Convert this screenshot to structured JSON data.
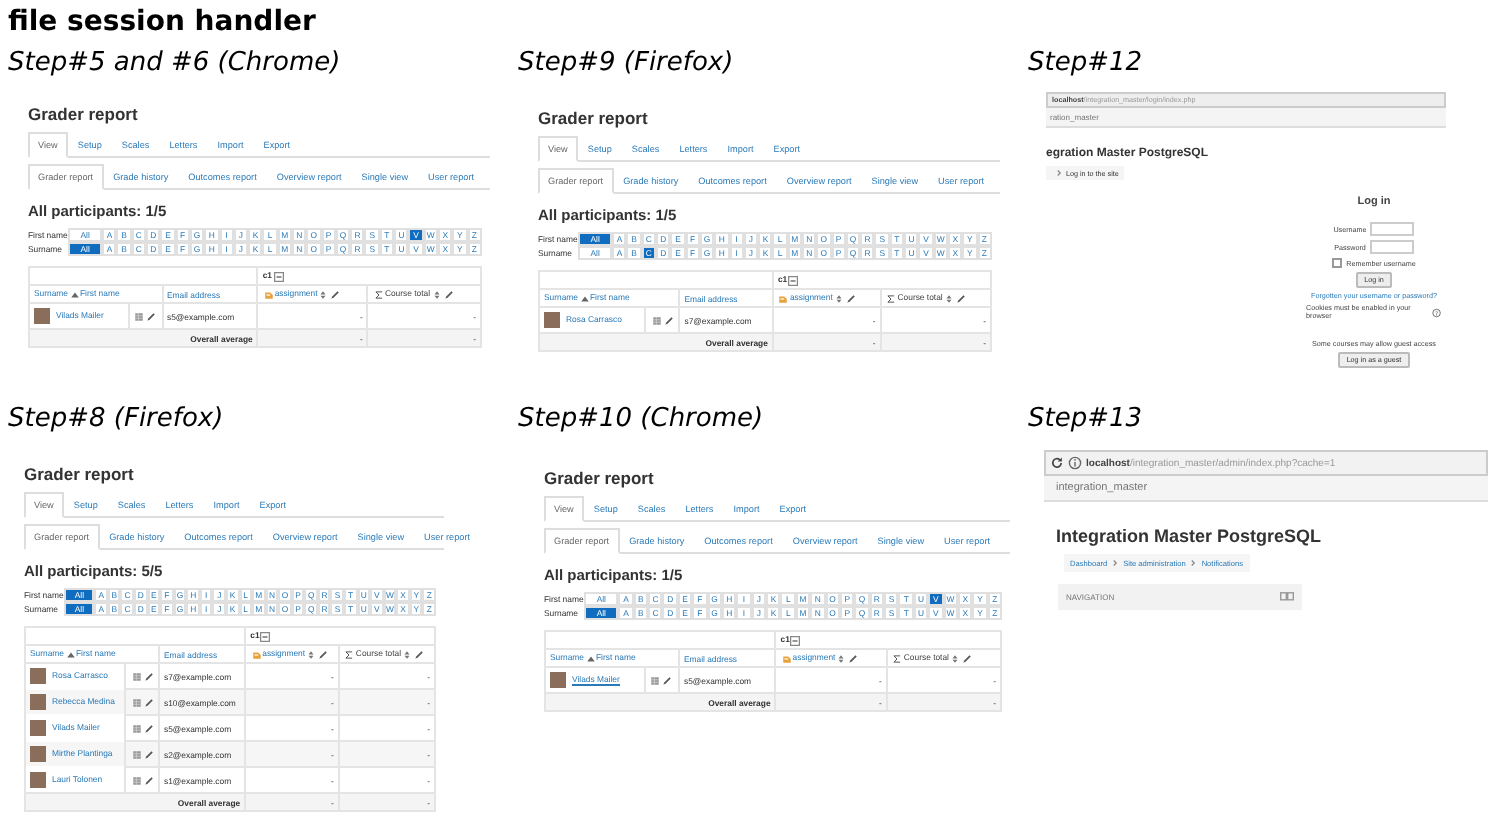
{
  "sheet_title": "file session handler",
  "panels": [
    {
      "kind": "grader",
      "caption": "Step#5 and #6 (Chrome)",
      "title": "Grader report",
      "tabs": [
        {
          "label": "View",
          "selected": true
        },
        {
          "label": "Setup",
          "selected": false
        },
        {
          "label": "Scales",
          "selected": false
        },
        {
          "label": "Letters",
          "selected": false
        },
        {
          "label": "Import",
          "selected": false
        },
        {
          "label": "Export",
          "selected": false
        }
      ],
      "subtabs": [
        {
          "label": "Grader report",
          "selected": true
        },
        {
          "label": "Grade history",
          "selected": false
        },
        {
          "label": "Outcomes report",
          "selected": false
        },
        {
          "label": "Overview report",
          "selected": false
        },
        {
          "label": "Single view",
          "selected": false
        },
        {
          "label": "User report",
          "selected": false
        }
      ],
      "participants": "All participants: 1/5",
      "filters": [
        {
          "label": "First name",
          "letters": [
            {
              "label": "All",
              "selected": false
            },
            {
              "label": "A",
              "selected": false
            },
            {
              "label": "B",
              "selected": false
            },
            {
              "label": "C",
              "selected": false
            },
            {
              "label": "D",
              "selected": false
            },
            {
              "label": "E",
              "selected": false
            },
            {
              "label": "F",
              "selected": false
            },
            {
              "label": "G",
              "selected": false
            },
            {
              "label": "H",
              "selected": false
            },
            {
              "label": "I",
              "selected": false
            },
            {
              "label": "J",
              "selected": false
            },
            {
              "label": "K",
              "selected": false
            },
            {
              "label": "L",
              "selected": false
            },
            {
              "label": "M",
              "selected": false
            },
            {
              "label": "N",
              "selected": false
            },
            {
              "label": "O",
              "selected": false
            },
            {
              "label": "P",
              "selected": false
            },
            {
              "label": "Q",
              "selected": false
            },
            {
              "label": "R",
              "selected": false
            },
            {
              "label": "S",
              "selected": false
            },
            {
              "label": "T",
              "selected": false
            },
            {
              "label": "U",
              "selected": false
            },
            {
              "label": "V",
              "selected": true
            },
            {
              "label": "W",
              "selected": false
            },
            {
              "label": "X",
              "selected": false
            },
            {
              "label": "Y",
              "selected": false
            },
            {
              "label": "Z",
              "selected": false
            }
          ]
        },
        {
          "label": "Surname",
          "letters": [
            {
              "label": "All",
              "selected": true
            },
            {
              "label": "A",
              "selected": false
            },
            {
              "label": "B",
              "selected": false
            },
            {
              "label": "C",
              "selected": false
            },
            {
              "label": "D",
              "selected": false
            },
            {
              "label": "E",
              "selected": false
            },
            {
              "label": "F",
              "selected": false
            },
            {
              "label": "G",
              "selected": false
            },
            {
              "label": "H",
              "selected": false
            },
            {
              "label": "I",
              "selected": false
            },
            {
              "label": "J",
              "selected": false
            },
            {
              "label": "K",
              "selected": false
            },
            {
              "label": "L",
              "selected": false
            },
            {
              "label": "M",
              "selected": false
            },
            {
              "label": "N",
              "selected": false
            },
            {
              "label": "O",
              "selected": false
            },
            {
              "label": "P",
              "selected": false
            },
            {
              "label": "Q",
              "selected": false
            },
            {
              "label": "R",
              "selected": false
            },
            {
              "label": "S",
              "selected": false
            },
            {
              "label": "T",
              "selected": false
            },
            {
              "label": "U",
              "selected": false
            },
            {
              "label": "V",
              "selected": false
            },
            {
              "label": "W",
              "selected": false
            },
            {
              "label": "X",
              "selected": false
            },
            {
              "label": "Y",
              "selected": false
            },
            {
              "label": "Z",
              "selected": false
            }
          ]
        }
      ],
      "table": {
        "category": "c1",
        "columns": [
          "Surname",
          "First name",
          "Email address",
          "assignment",
          "Course total"
        ],
        "rows": [
          {
            "name": "Vilads Mailer",
            "email": "s5@example.com",
            "grade": "-",
            "total": "-",
            "underlined": false
          }
        ],
        "footer": {
          "label": "Overall average",
          "grade": "-",
          "total": "-"
        }
      }
    },
    {
      "kind": "grader",
      "caption": "Step#9 (Firefox)",
      "title": "Grader report",
      "tabs": [
        {
          "label": "View",
          "selected": true
        },
        {
          "label": "Setup",
          "selected": false
        },
        {
          "label": "Scales",
          "selected": false
        },
        {
          "label": "Letters",
          "selected": false
        },
        {
          "label": "Import",
          "selected": false
        },
        {
          "label": "Export",
          "selected": false
        }
      ],
      "subtabs": [
        {
          "label": "Grader report",
          "selected": true
        },
        {
          "label": "Grade history",
          "selected": false
        },
        {
          "label": "Outcomes report",
          "selected": false
        },
        {
          "label": "Overview report",
          "selected": false
        },
        {
          "label": "Single view",
          "selected": false
        },
        {
          "label": "User report",
          "selected": false
        }
      ],
      "participants": "All participants: 1/5",
      "filters": [
        {
          "label": "First name",
          "letters": [
            {
              "label": "All",
              "selected": true
            },
            {
              "label": "A",
              "selected": false
            },
            {
              "label": "B",
              "selected": false
            },
            {
              "label": "C",
              "selected": false
            },
            {
              "label": "D",
              "selected": false
            },
            {
              "label": "E",
              "selected": false
            },
            {
              "label": "F",
              "selected": false
            },
            {
              "label": "G",
              "selected": false
            },
            {
              "label": "H",
              "selected": false
            },
            {
              "label": "I",
              "selected": false
            },
            {
              "label": "J",
              "selected": false
            },
            {
              "label": "K",
              "selected": false
            },
            {
              "label": "L",
              "selected": false
            },
            {
              "label": "M",
              "selected": false
            },
            {
              "label": "N",
              "selected": false
            },
            {
              "label": "O",
              "selected": false
            },
            {
              "label": "P",
              "selected": false
            },
            {
              "label": "Q",
              "selected": false
            },
            {
              "label": "R",
              "selected": false
            },
            {
              "label": "S",
              "selected": false
            },
            {
              "label": "T",
              "selected": false
            },
            {
              "label": "U",
              "selected": false
            },
            {
              "label": "V",
              "selected": false
            },
            {
              "label": "W",
              "selected": false
            },
            {
              "label": "X",
              "selected": false
            },
            {
              "label": "Y",
              "selected": false
            },
            {
              "label": "Z",
              "selected": false
            }
          ]
        },
        {
          "label": "Surname",
          "letters": [
            {
              "label": "All",
              "selected": false
            },
            {
              "label": "A",
              "selected": false
            },
            {
              "label": "B",
              "selected": false
            },
            {
              "label": "C",
              "selected": true
            },
            {
              "label": "D",
              "selected": false
            },
            {
              "label": "E",
              "selected": false
            },
            {
              "label": "F",
              "selected": false
            },
            {
              "label": "G",
              "selected": false
            },
            {
              "label": "H",
              "selected": false
            },
            {
              "label": "I",
              "selected": false
            },
            {
              "label": "J",
              "selected": false
            },
            {
              "label": "K",
              "selected": false
            },
            {
              "label": "L",
              "selected": false
            },
            {
              "label": "M",
              "selected": false
            },
            {
              "label": "N",
              "selected": false
            },
            {
              "label": "O",
              "selected": false
            },
            {
              "label": "P",
              "selected": false
            },
            {
              "label": "Q",
              "selected": false
            },
            {
              "label": "R",
              "selected": false
            },
            {
              "label": "S",
              "selected": false
            },
            {
              "label": "T",
              "selected": false
            },
            {
              "label": "U",
              "selected": false
            },
            {
              "label": "V",
              "selected": false
            },
            {
              "label": "W",
              "selected": false
            },
            {
              "label": "X",
              "selected": false
            },
            {
              "label": "Y",
              "selected": false
            },
            {
              "label": "Z",
              "selected": false
            }
          ]
        }
      ],
      "table": {
        "category": "c1",
        "columns": [
          "Surname",
          "First name",
          "Email address",
          "assignment",
          "Course total"
        ],
        "rows": [
          {
            "name": "Rosa Carrasco",
            "email": "s7@example.com",
            "grade": "-",
            "total": "-",
            "underlined": false
          }
        ],
        "footer": {
          "label": "Overall average",
          "grade": "-",
          "total": "-"
        }
      }
    },
    {
      "kind": "login",
      "caption": "Step#12",
      "url_host": "localhost",
      "url_path": "/integration_master/login/index.php",
      "site_name": "ration_master",
      "heading": "egration Master PostgreSQL",
      "breadcrumb": [
        "Log in to the site"
      ],
      "login_title": "Log in",
      "username_label": "Username",
      "password_label": "Password",
      "remember_label": "Remember username",
      "remember_checked": false,
      "login_button": "Log in",
      "forgot_link": "Forgotten your username or password?",
      "cookies_note": "Cookies must be enabled in your browser",
      "guest_note": "Some courses may allow guest access",
      "guest_button": "Log in as a guest"
    },
    {
      "kind": "grader",
      "caption": "Step#8 (Firefox)",
      "title": "Grader report",
      "tabs": [
        {
          "label": "View",
          "selected": true
        },
        {
          "label": "Setup",
          "selected": false
        },
        {
          "label": "Scales",
          "selected": false
        },
        {
          "label": "Letters",
          "selected": false
        },
        {
          "label": "Import",
          "selected": false
        },
        {
          "label": "Export",
          "selected": false
        }
      ],
      "subtabs": [
        {
          "label": "Grader report",
          "selected": true
        },
        {
          "label": "Grade history",
          "selected": false
        },
        {
          "label": "Outcomes report",
          "selected": false
        },
        {
          "label": "Overview report",
          "selected": false
        },
        {
          "label": "Single view",
          "selected": false
        },
        {
          "label": "User report",
          "selected": false
        }
      ],
      "participants": "All participants: 5/5",
      "filters": [
        {
          "label": "First name",
          "letters": [
            {
              "label": "All",
              "selected": true
            },
            {
              "label": "A",
              "selected": false
            },
            {
              "label": "B",
              "selected": false
            },
            {
              "label": "C",
              "selected": false
            },
            {
              "label": "D",
              "selected": false
            },
            {
              "label": "E",
              "selected": false
            },
            {
              "label": "F",
              "selected": false
            },
            {
              "label": "G",
              "selected": false
            },
            {
              "label": "H",
              "selected": false
            },
            {
              "label": "I",
              "selected": false
            },
            {
              "label": "J",
              "selected": false
            },
            {
              "label": "K",
              "selected": false
            },
            {
              "label": "L",
              "selected": false
            },
            {
              "label": "M",
              "selected": false
            },
            {
              "label": "N",
              "selected": false
            },
            {
              "label": "O",
              "selected": false
            },
            {
              "label": "P",
              "selected": false
            },
            {
              "label": "Q",
              "selected": false
            },
            {
              "label": "R",
              "selected": false
            },
            {
              "label": "S",
              "selected": false
            },
            {
              "label": "T",
              "selected": false
            },
            {
              "label": "U",
              "selected": false
            },
            {
              "label": "V",
              "selected": false
            },
            {
              "label": "W",
              "selected": false
            },
            {
              "label": "X",
              "selected": false
            },
            {
              "label": "Y",
              "selected": false
            },
            {
              "label": "Z",
              "selected": false
            }
          ]
        },
        {
          "label": "Surname",
          "letters": [
            {
              "label": "All",
              "selected": true
            },
            {
              "label": "A",
              "selected": false
            },
            {
              "label": "B",
              "selected": false
            },
            {
              "label": "C",
              "selected": false
            },
            {
              "label": "D",
              "selected": false
            },
            {
              "label": "E",
              "selected": false
            },
            {
              "label": "F",
              "selected": false
            },
            {
              "label": "G",
              "selected": false
            },
            {
              "label": "H",
              "selected": false
            },
            {
              "label": "I",
              "selected": false
            },
            {
              "label": "J",
              "selected": false
            },
            {
              "label": "K",
              "selected": false
            },
            {
              "label": "L",
              "selected": false
            },
            {
              "label": "M",
              "selected": false
            },
            {
              "label": "N",
              "selected": false
            },
            {
              "label": "O",
              "selected": false
            },
            {
              "label": "P",
              "selected": false
            },
            {
              "label": "Q",
              "selected": false
            },
            {
              "label": "R",
              "selected": false
            },
            {
              "label": "S",
              "selected": false
            },
            {
              "label": "T",
              "selected": false
            },
            {
              "label": "U",
              "selected": false
            },
            {
              "label": "V",
              "selected": false
            },
            {
              "label": "W",
              "selected": false
            },
            {
              "label": "X",
              "selected": false
            },
            {
              "label": "Y",
              "selected": false
            },
            {
              "label": "Z",
              "selected": false
            }
          ]
        }
      ],
      "table": {
        "category": "c1",
        "columns": [
          "Surname",
          "First name",
          "Email address",
          "assignment",
          "Course total"
        ],
        "rows": [
          {
            "name": "Rosa Carrasco",
            "email": "s7@example.com",
            "grade": "-",
            "total": "-",
            "underlined": false
          },
          {
            "name": "Rebecca Medina",
            "email": "s10@example.com",
            "grade": "-",
            "total": "-",
            "underlined": false
          },
          {
            "name": "Vilads Mailer",
            "email": "s5@example.com",
            "grade": "-",
            "total": "-",
            "underlined": false
          },
          {
            "name": "Mirthe Plantinga",
            "email": "s2@example.com",
            "grade": "-",
            "total": "-",
            "underlined": false
          },
          {
            "name": "Lauri Tolonen",
            "email": "s1@example.com",
            "grade": "-",
            "total": "-",
            "underlined": false
          }
        ],
        "footer": {
          "label": "Overall average",
          "grade": "-",
          "total": "-"
        }
      }
    },
    {
      "kind": "grader",
      "caption": "Step#10 (Chrome)",
      "title": "Grader report",
      "tabs": [
        {
          "label": "View",
          "selected": true
        },
        {
          "label": "Setup",
          "selected": false
        },
        {
          "label": "Scales",
          "selected": false
        },
        {
          "label": "Letters",
          "selected": false
        },
        {
          "label": "Import",
          "selected": false
        },
        {
          "label": "Export",
          "selected": false
        }
      ],
      "subtabs": [
        {
          "label": "Grader report",
          "selected": true
        },
        {
          "label": "Grade history",
          "selected": false
        },
        {
          "label": "Outcomes report",
          "selected": false
        },
        {
          "label": "Overview report",
          "selected": false
        },
        {
          "label": "Single view",
          "selected": false
        },
        {
          "label": "User report",
          "selected": false
        }
      ],
      "participants": "All participants: 1/5",
      "filters": [
        {
          "label": "First name",
          "letters": [
            {
              "label": "All",
              "selected": false
            },
            {
              "label": "A",
              "selected": false
            },
            {
              "label": "B",
              "selected": false
            },
            {
              "label": "C",
              "selected": false
            },
            {
              "label": "D",
              "selected": false
            },
            {
              "label": "E",
              "selected": false
            },
            {
              "label": "F",
              "selected": false
            },
            {
              "label": "G",
              "selected": false
            },
            {
              "label": "H",
              "selected": false
            },
            {
              "label": "I",
              "selected": false
            },
            {
              "label": "J",
              "selected": false
            },
            {
              "label": "K",
              "selected": false
            },
            {
              "label": "L",
              "selected": false
            },
            {
              "label": "M",
              "selected": false
            },
            {
              "label": "N",
              "selected": false
            },
            {
              "label": "O",
              "selected": false
            },
            {
              "label": "P",
              "selected": false
            },
            {
              "label": "Q",
              "selected": false
            },
            {
              "label": "R",
              "selected": false
            },
            {
              "label": "S",
              "selected": false
            },
            {
              "label": "T",
              "selected": false
            },
            {
              "label": "U",
              "selected": false
            },
            {
              "label": "V",
              "selected": true
            },
            {
              "label": "W",
              "selected": false
            },
            {
              "label": "X",
              "selected": false
            },
            {
              "label": "Y",
              "selected": false
            },
            {
              "label": "Z",
              "selected": false
            }
          ]
        },
        {
          "label": "Surname",
          "letters": [
            {
              "label": "All",
              "selected": true
            },
            {
              "label": "A",
              "selected": false
            },
            {
              "label": "B",
              "selected": false
            },
            {
              "label": "C",
              "selected": false
            },
            {
              "label": "D",
              "selected": false
            },
            {
              "label": "E",
              "selected": false
            },
            {
              "label": "F",
              "selected": false
            },
            {
              "label": "G",
              "selected": false
            },
            {
              "label": "H",
              "selected": false
            },
            {
              "label": "I",
              "selected": false
            },
            {
              "label": "J",
              "selected": false
            },
            {
              "label": "K",
              "selected": false
            },
            {
              "label": "L",
              "selected": false
            },
            {
              "label": "M",
              "selected": false
            },
            {
              "label": "N",
              "selected": false
            },
            {
              "label": "O",
              "selected": false
            },
            {
              "label": "P",
              "selected": false
            },
            {
              "label": "Q",
              "selected": false
            },
            {
              "label": "R",
              "selected": false
            },
            {
              "label": "S",
              "selected": false
            },
            {
              "label": "T",
              "selected": false
            },
            {
              "label": "U",
              "selected": false
            },
            {
              "label": "V",
              "selected": false
            },
            {
              "label": "W",
              "selected": false
            },
            {
              "label": "X",
              "selected": false
            },
            {
              "label": "Y",
              "selected": false
            },
            {
              "label": "Z",
              "selected": false
            }
          ]
        }
      ],
      "table": {
        "category": "c1",
        "columns": [
          "Surname",
          "First name",
          "Email address",
          "assignment",
          "Course total"
        ],
        "rows": [
          {
            "name": "Vilads Mailer",
            "email": "s5@example.com",
            "grade": "-",
            "total": "-",
            "underlined": true
          }
        ],
        "footer": {
          "label": "Overall average",
          "grade": "-",
          "total": "-"
        }
      }
    },
    {
      "kind": "admin",
      "caption": "Step#13",
      "url_host": "localhost",
      "url_path": "/integration_master/admin/index.php?cache=1",
      "site_name": "integration_master",
      "heading": "Integration Master PostgreSQL",
      "breadcrumb": [
        "Dashboard",
        "Site administration",
        "Notifications"
      ],
      "block_title": "NAVIGATION"
    }
  ]
}
